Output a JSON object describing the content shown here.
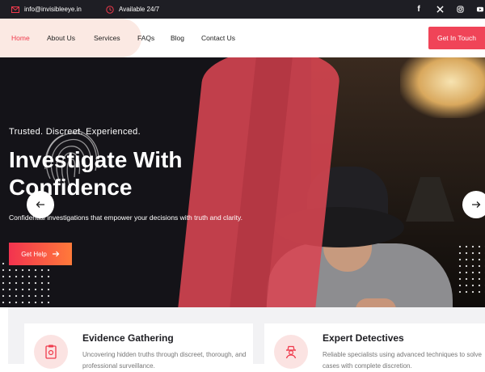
{
  "topbar": {
    "email": "info@invisibleeye.in",
    "hours": "Available 24/7",
    "social": [
      "facebook-icon",
      "x-icon",
      "instagram-icon",
      "youtube-icon"
    ]
  },
  "nav": {
    "links": [
      "Home",
      "About Us",
      "Services",
      "FAQs",
      "Blog",
      "Contact Us"
    ],
    "active": "Home",
    "cta_label": "Get In Touch"
  },
  "hero": {
    "eyebrow": "Trusted. Discreet. Experienced.",
    "headline_line1": "Investigate With",
    "headline_line2": "Confidence",
    "subtext": "Confidential investigations that empower your decisions with truth and clarity.",
    "button_label": "Get Help"
  },
  "features": [
    {
      "title": "Evidence Gathering",
      "description": "Uncovering hidden truths through discreet, thorough, and professional surveillance.",
      "icon": "file-evidence-icon"
    },
    {
      "title": "Expert Detectives",
      "description": "Reliable specialists using advanced techniques to solve cases with complete discretion.",
      "icon": "detective-icon"
    }
  ],
  "colors": {
    "accent": "#f04458",
    "topbar_bg": "#1e1e24",
    "hero_bg": "#141318",
    "nav_tint": "#fbe9e3"
  }
}
